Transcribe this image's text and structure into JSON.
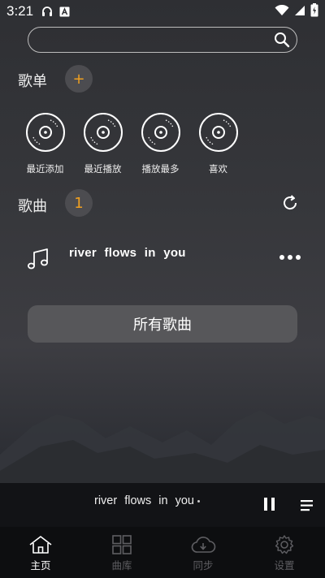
{
  "status_bar": {
    "time": "3:21",
    "icons": [
      "headphones-icon",
      "a-icon",
      "wifi-icon",
      "signal-icon",
      "battery-charging-icon"
    ]
  },
  "search": {
    "value": "",
    "placeholder": ""
  },
  "playlists_section": {
    "title": "歌单",
    "add_label": "+",
    "items": [
      {
        "label": "最近添加",
        "icon": "disc-icon"
      },
      {
        "label": "最近播放",
        "icon": "disc-icon"
      },
      {
        "label": "播放最多",
        "icon": "disc-icon"
      },
      {
        "label": "喜欢",
        "icon": "disc-icon"
      }
    ]
  },
  "songs_section": {
    "title": "歌曲",
    "count": "1",
    "songs": [
      {
        "title": "river flows in you"
      }
    ]
  },
  "all_songs_button": "所有歌曲",
  "now_playing": {
    "title": "river flows in you"
  },
  "bottom_nav": [
    {
      "label": "主页",
      "icon": "home-icon",
      "active": true
    },
    {
      "label": "曲库",
      "icon": "grid-icon",
      "active": false
    },
    {
      "label": "同步",
      "icon": "cloud-download-icon",
      "active": false
    },
    {
      "label": "设置",
      "icon": "gear-icon",
      "active": false
    }
  ],
  "colors": {
    "accent": "#f0a020",
    "pill_bg": "#4c4c50",
    "button_bg": "#57575a",
    "player_bg": "#121316",
    "nav_bg": "#0d0e10"
  }
}
